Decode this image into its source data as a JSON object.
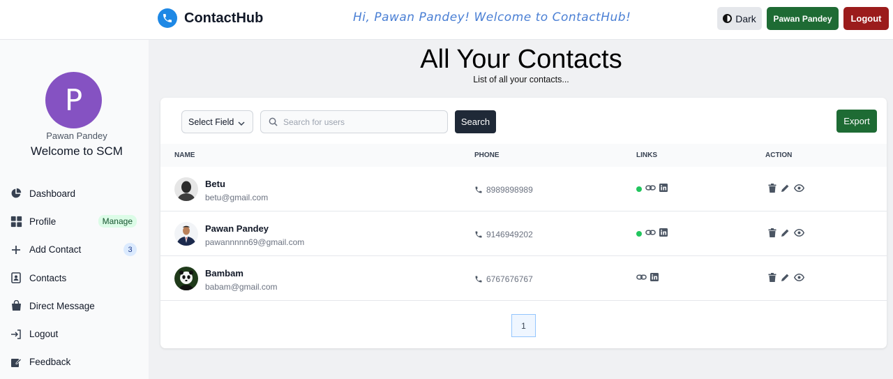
{
  "brand": {
    "name": "ContactHub"
  },
  "header": {
    "welcome": "Hi, Pawan Pandey! Welcome to ContactHub!",
    "dark_label": "Dark",
    "user_label": "Pawan Pandey",
    "logout_label": "Logout"
  },
  "sidebar": {
    "avatar_letter": "P",
    "user_name": "Pawan Pandey",
    "welcome": "Welcome to SCM",
    "items": [
      {
        "label": "Dashboard",
        "icon": "pie-chart-icon"
      },
      {
        "label": "Profile",
        "icon": "grid-icon",
        "badge": "Manage"
      },
      {
        "label": "Add Contact",
        "icon": "plus-icon",
        "badge": "3"
      },
      {
        "label": "Contacts",
        "icon": "address-book-icon"
      },
      {
        "label": "Direct Message",
        "icon": "bag-icon"
      },
      {
        "label": "Logout",
        "icon": "sign-out-icon"
      },
      {
        "label": "Feedback",
        "icon": "feedback-icon"
      }
    ]
  },
  "main": {
    "title": "All Your Contacts",
    "subtitle": "List of all your contacts...",
    "select_label": "Select Field",
    "search_placeholder": "Search for users",
    "search_button": "Search",
    "export_button": "Export",
    "columns": [
      "NAME",
      "PHONE",
      "LINKS",
      "ACTION"
    ],
    "contacts": [
      {
        "name": "Betu",
        "email": "betu@gmail.com",
        "phone": "8989898989",
        "favorite": true
      },
      {
        "name": "Pawan Pandey",
        "email": "pawannnnn69@gmail.com",
        "phone": "9146949202",
        "favorite": true
      },
      {
        "name": "Bambam",
        "email": "babam@gmail.com",
        "phone": "6767676767",
        "favorite": false
      }
    ],
    "page": "1"
  },
  "colors": {
    "accent_green": "#1e6b34",
    "logout_red": "#9b1c1c",
    "avatar_purple": "#8552c2",
    "brand_blue": "#1e88e5"
  }
}
